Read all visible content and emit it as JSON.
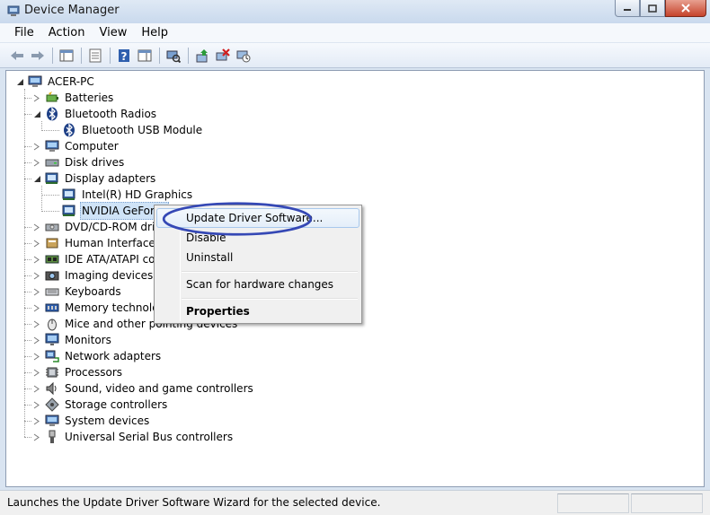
{
  "window": {
    "title": "Device Manager"
  },
  "menu": [
    "File",
    "Action",
    "View",
    "Help"
  ],
  "toolbar": {
    "buttons": [
      "back-icon",
      "forward-icon",
      "show-hide-console-tree-icon",
      "properties-icon",
      "help-icon",
      "action-pane-icon",
      "scan-hardware-icon",
      "update-driver-icon",
      "uninstall-icon",
      "disable-icon"
    ]
  },
  "tree": {
    "root": "ACER-PC",
    "items": [
      {
        "label": "Batteries",
        "icon": "battery-icon"
      },
      {
        "label": "Bluetooth Radios",
        "icon": "bluetooth-icon",
        "expanded": true,
        "children": [
          {
            "label": "Bluetooth USB Module",
            "icon": "bluetooth-icon"
          }
        ]
      },
      {
        "label": "Computer",
        "icon": "computer-icon"
      },
      {
        "label": "Disk drives",
        "icon": "disk-drive-icon"
      },
      {
        "label": "Display adapters",
        "icon": "display-adapter-icon",
        "expanded": true,
        "children": [
          {
            "label": "Intel(R) HD Graphics",
            "icon": "display-adapter-icon"
          },
          {
            "label": "NVIDIA GeForce",
            "icon": "display-adapter-icon",
            "selected": true
          }
        ]
      },
      {
        "label": "DVD/CD-ROM drives",
        "icon": "dvd-drive-icon"
      },
      {
        "label": "Human Interface Devices",
        "icon": "hid-icon"
      },
      {
        "label": "IDE ATA/ATAPI controllers",
        "icon": "ide-controller-icon"
      },
      {
        "label": "Imaging devices",
        "icon": "camera-icon"
      },
      {
        "label": "Keyboards",
        "icon": "keyboard-icon"
      },
      {
        "label": "Memory technology devices",
        "icon": "memory-icon"
      },
      {
        "label": "Mice and other pointing devices",
        "icon": "mouse-icon"
      },
      {
        "label": "Monitors",
        "icon": "monitor-icon"
      },
      {
        "label": "Network adapters",
        "icon": "network-adapter-icon"
      },
      {
        "label": "Processors",
        "icon": "processor-icon"
      },
      {
        "label": "Sound, video and game controllers",
        "icon": "speaker-icon"
      },
      {
        "label": "Storage controllers",
        "icon": "storage-controller-icon"
      },
      {
        "label": "System devices",
        "icon": "system-devices-icon"
      },
      {
        "label": "Universal Serial Bus controllers",
        "icon": "usb-icon"
      }
    ]
  },
  "context_menu": {
    "items": [
      {
        "label": "Update Driver Software...",
        "highlighted": true
      },
      {
        "label": "Disable"
      },
      {
        "label": "Uninstall"
      },
      {
        "separator": true
      },
      {
        "label": "Scan for hardware changes"
      },
      {
        "separator": true
      },
      {
        "label": "Properties",
        "bold": true
      }
    ]
  },
  "statusbar": {
    "text": "Launches the Update Driver Software Wizard for the selected device."
  },
  "colors": {
    "annotation": "#3548b5",
    "selection": "#cfe3f7",
    "title_bar": "#c9d9ed"
  }
}
